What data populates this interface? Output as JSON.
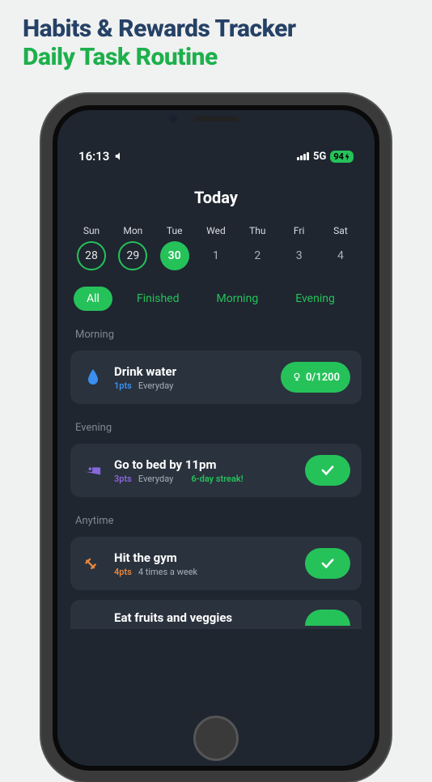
{
  "promo": {
    "line1": "Habits & Rewards Tracker",
    "line2": "Daily Task Routine"
  },
  "status": {
    "time": "16:13",
    "network": "5G",
    "battery": "94"
  },
  "header": {
    "title": "Today"
  },
  "week": [
    {
      "day": "Sun",
      "num": "28",
      "ring": true,
      "active": false
    },
    {
      "day": "Mon",
      "num": "29",
      "ring": true,
      "active": false
    },
    {
      "day": "Tue",
      "num": "30",
      "ring": false,
      "active": true
    },
    {
      "day": "Wed",
      "num": "1",
      "ring": false,
      "active": false
    },
    {
      "day": "Thu",
      "num": "2",
      "ring": false,
      "active": false
    },
    {
      "day": "Fri",
      "num": "3",
      "ring": false,
      "active": false
    },
    {
      "day": "Sat",
      "num": "4",
      "ring": false,
      "active": false
    }
  ],
  "filters": [
    {
      "label": "All",
      "active": true
    },
    {
      "label": "Finished",
      "active": false
    },
    {
      "label": "Morning",
      "active": false
    },
    {
      "label": "Evening",
      "active": false
    }
  ],
  "sections": {
    "morning": {
      "label": "Morning",
      "task": {
        "title": "Drink water",
        "pts": "1pts",
        "freq": "Everyday",
        "progress": "0/1200",
        "icon": "water-drop-icon",
        "color": "#3a8ff0"
      }
    },
    "evening": {
      "label": "Evening",
      "task": {
        "title": "Go to bed by 11pm",
        "pts": "3pts",
        "freq": "Everyday",
        "streak": "6-day streak!",
        "icon": "bed-icon",
        "color": "#8668d9"
      }
    },
    "anytime": {
      "label": "Anytime",
      "task1": {
        "title": "Hit the gym",
        "pts": "4pts",
        "freq": "4 times a week",
        "icon": "dumbbell-icon",
        "color": "#e8863c"
      },
      "task2": {
        "title": "Eat fruits and veggies",
        "icon": "veggie-icon"
      }
    }
  }
}
